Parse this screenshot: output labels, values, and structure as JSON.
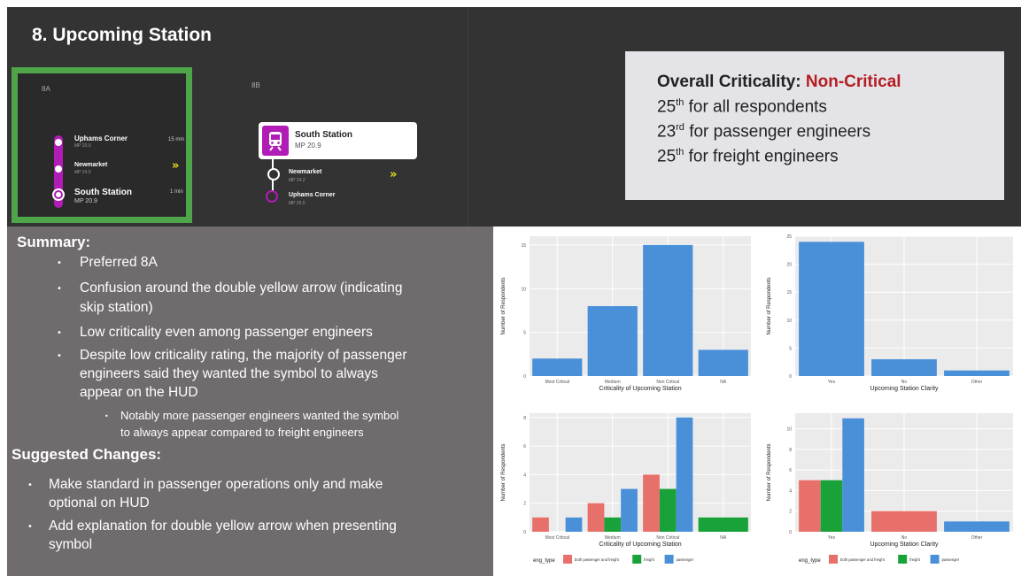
{
  "slide_title": "8. Upcoming Station",
  "panel_8a": {
    "label": "8A",
    "stations": [
      {
        "name": "Uphams Corner",
        "mp": "MP 20.0",
        "time": "15 min"
      },
      {
        "name": "Newmarket",
        "mp": "MP 24.0",
        "time": ""
      },
      {
        "name": "South Station",
        "mp": "MP 20.9",
        "time": "1 min"
      }
    ],
    "arrow_glyph": "»"
  },
  "panel_8b": {
    "label": "8B",
    "current": {
      "name": "South Station",
      "mp": "MP 20.9"
    },
    "stations": [
      {
        "name": "Newmarket",
        "mp": "MP 24.2"
      },
      {
        "name": "Uphams Corner",
        "mp": "MP 26.0"
      }
    ],
    "arrow_glyph": "»"
  },
  "criticality": {
    "heading": "Overall Criticality: ",
    "value": "Non-Critical",
    "value_color": "#b31e22",
    "lines": [
      {
        "num": "25",
        "sup": "th",
        "text": " for all respondents"
      },
      {
        "num": "23",
        "sup": "rd",
        "text": " for passenger engineers"
      },
      {
        "num": "25",
        "sup": "th",
        "text": " for freight engineers"
      }
    ]
  },
  "summary": {
    "heading": "Summary:",
    "items": [
      "Preferred 8A",
      "Confusion around the double yellow arrow (indicating",
      "skip station)",
      "Low criticality even among passenger engineers",
      "Despite low criticality rating, the majority of passenger",
      "engineers said they wanted the symbol to always",
      "appear on the HUD"
    ],
    "sub_items": [
      "Notably more passenger engineers wanted the symbol",
      "to always appear compared to freight engineers"
    ]
  },
  "suggested": {
    "heading": "Suggested Changes:",
    "items": [
      "Make standard in passenger operations only and make",
      "optional on HUD",
      "Add explanation for double yellow arrow when presenting",
      "symbol"
    ]
  },
  "colors": {
    "bar_blue": "#4a90d9",
    "bar_red": "#e8706a",
    "bar_green": "#1aa23a",
    "accent_green": "#4fa64a",
    "route_magenta": "#b01cb5"
  },
  "chart_data": [
    {
      "type": "bar",
      "categories": [
        "Most Critical",
        "Medium",
        "Non Critical",
        "NA"
      ],
      "values": [
        2,
        8,
        15,
        3
      ],
      "xlabel": "Criticality of Upcoming Station",
      "ylabel": "Number of Respondents",
      "ylim": [
        0,
        16
      ],
      "yticks": [
        0,
        5,
        10,
        15
      ],
      "grid": true
    },
    {
      "type": "bar",
      "categories": [
        "Yes",
        "No",
        "Other"
      ],
      "values": [
        24,
        3,
        1
      ],
      "xlabel": "Upcoming Station Clarity",
      "ylabel": "Number of Respondents",
      "ylim": [
        0,
        25
      ],
      "yticks": [
        0,
        5,
        10,
        15,
        20,
        25
      ],
      "grid": true
    },
    {
      "type": "bar",
      "categories": [
        "Most Critical",
        "Medium",
        "Non Critical",
        "NA"
      ],
      "series": [
        {
          "name": "both passenger and freight",
          "values": [
            1,
            2,
            4,
            0
          ]
        },
        {
          "name": "freight",
          "values": [
            0,
            1,
            3,
            1
          ]
        },
        {
          "name": "passenger",
          "values": [
            1,
            3,
            8,
            0
          ]
        }
      ],
      "xlabel": "Criticality of Upcoming Station",
      "ylabel": "Number of Respondents",
      "ylim": [
        0,
        8.3
      ],
      "yticks": [
        0,
        2,
        4,
        6,
        8
      ],
      "legend_title": "eng_type",
      "legend_position": "bottom",
      "grid": true
    },
    {
      "type": "bar",
      "categories": [
        "Yes",
        "No",
        "Other"
      ],
      "series": [
        {
          "name": "both passenger and freight",
          "values": [
            5,
            2,
            0
          ]
        },
        {
          "name": "freight",
          "values": [
            5,
            0,
            0
          ]
        },
        {
          "name": "passenger",
          "values": [
            11,
            0,
            1
          ]
        }
      ],
      "xlabel": "Upcoming Station Clarity",
      "ylabel": "Number of Respondents",
      "ylim": [
        0,
        11.5
      ],
      "yticks": [
        0,
        2,
        4,
        6,
        8,
        10
      ],
      "legend_title": "eng_type",
      "legend_position": "bottom",
      "grid": true
    }
  ]
}
